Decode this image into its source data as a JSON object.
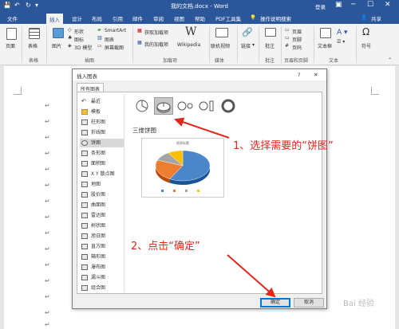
{
  "window": {
    "title": "我的文档.docx - Word",
    "quick_access": [
      "💾",
      "↶",
      "↻",
      "▾"
    ],
    "controls": {
      "login": "登录",
      "restore": "▣",
      "minimize": "─",
      "maximize": "☐",
      "close": "✕"
    }
  },
  "tabs": [
    "文件",
    "插入",
    "设计",
    "布局",
    "引用",
    "邮件",
    "审阅",
    "视图",
    "帮助",
    "PDF工具集",
    "操作说明搜索"
  ],
  "share": "共享",
  "ribbon": {
    "groups": [
      {
        "label": "",
        "items": [
          "页面"
        ]
      },
      {
        "label": "表格",
        "items": [
          "表格"
        ]
      },
      {
        "label": "插图",
        "items": [
          "图片",
          "形状",
          "图标",
          "3D 模型",
          "SmartArt",
          "图表",
          "屏幕截图"
        ]
      },
      {
        "label": "加载项",
        "items": [
          "获取加载项",
          "我的加载项",
          "Wikipedia"
        ]
      },
      {
        "label": "媒体",
        "items": [
          "联机视频"
        ]
      },
      {
        "label": "",
        "items": [
          "链接"
        ]
      },
      {
        "label": "批注",
        "items": [
          "批注"
        ]
      },
      {
        "label": "页眉和页脚",
        "items": [
          "页眉",
          "页脚",
          "页码"
        ]
      },
      {
        "label": "文本",
        "items": [
          "文本框"
        ]
      },
      {
        "label": "",
        "items": [
          "符号"
        ]
      }
    ]
  },
  "dialog": {
    "title": "插入图表",
    "help": "?",
    "close": "✕",
    "tab": "所有图表",
    "categories": [
      "最近",
      "模板",
      "柱形图",
      "折线图",
      "饼图",
      "条形图",
      "面积图",
      "X Y 散点图",
      "地图",
      "股价图",
      "曲面图",
      "雷达图",
      "树状图",
      "旭日图",
      "直方图",
      "箱形图",
      "瀑布图",
      "漏斗图",
      "组合图"
    ],
    "selected_category": "饼图",
    "subtypes": [
      "饼图",
      "三维饼图",
      "子母饼图",
      "复合条饼图",
      "圆环图"
    ],
    "selected_subtype": "三维饼图",
    "subtype_title": "三维饼图",
    "preview_title": "图表标题",
    "ok": "确定",
    "cancel": "取消"
  },
  "annotations": {
    "step1": "1、选择需要的“饼图”",
    "step2": "2、点击“确定”"
  },
  "watermark": "Bai 经验",
  "chart_data": {
    "type": "pie",
    "title": "图表标题",
    "slices": [
      {
        "value": 58,
        "color": "#4a86c8"
      },
      {
        "value": 23,
        "color": "#ed7d31"
      },
      {
        "value": 10,
        "color": "#a5a5a5"
      },
      {
        "value": 9,
        "color": "#ffc000"
      }
    ]
  },
  "colors": {
    "word_blue": "#2b579a",
    "annotation_red": "#e0281e",
    "ok_border": "#0078d7"
  }
}
